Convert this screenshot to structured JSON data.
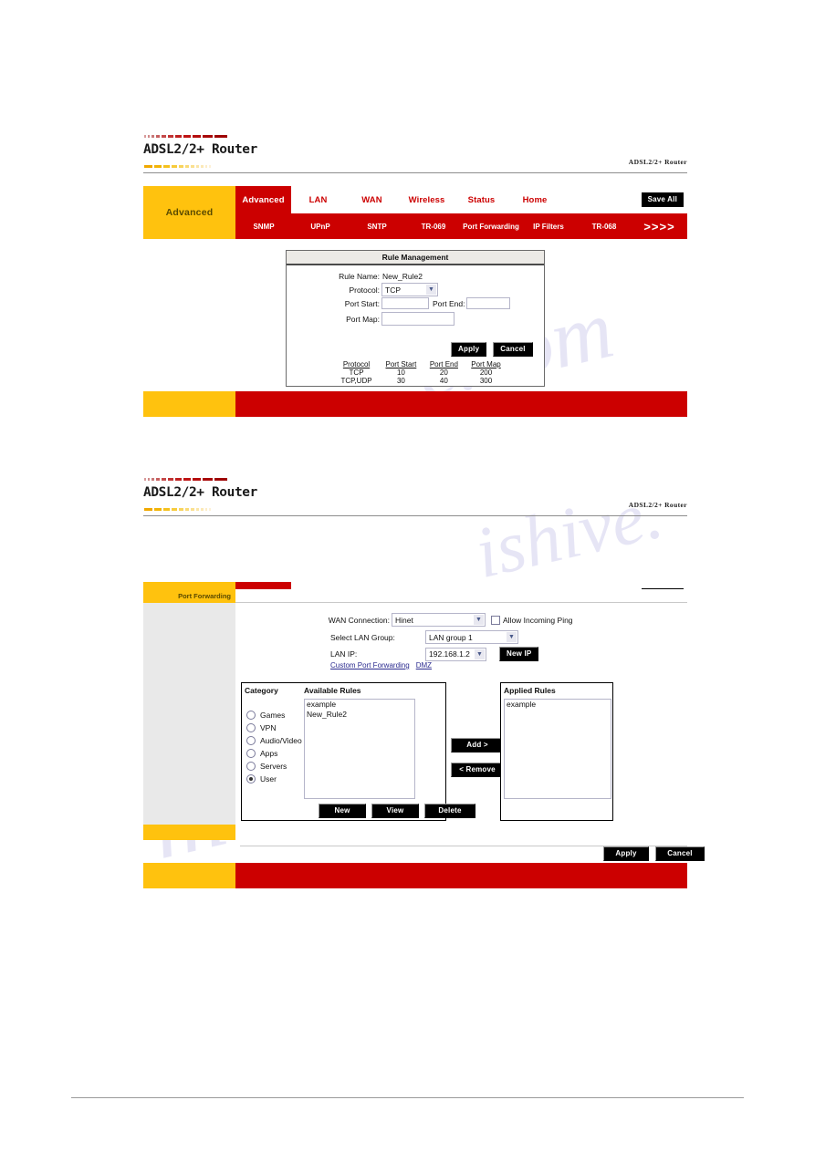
{
  "brand": {
    "logo_text": "ADSL2/2+ Router",
    "corner_text": "ADSL2/2+ Router"
  },
  "nav": {
    "left_label": "Advanced",
    "save_all_label": "Save All",
    "top_tabs": [
      {
        "label": "Advanced",
        "active": true
      },
      {
        "label": "LAN",
        "active": false
      },
      {
        "label": "WAN",
        "active": false
      },
      {
        "label": "Wireless",
        "active": false
      },
      {
        "label": "Status",
        "active": false
      },
      {
        "label": "Home",
        "active": false
      }
    ],
    "sub_tabs": [
      {
        "label": "SNMP"
      },
      {
        "label": "UPnP"
      },
      {
        "label": "SNTP"
      },
      {
        "label": "TR-069"
      },
      {
        "label": "Port Forwarding"
      },
      {
        "label": "IP Filters"
      },
      {
        "label": "TR-068"
      },
      {
        "label": ">>>>"
      }
    ]
  },
  "rule_management": {
    "title": "Rule Management",
    "rule_name_label": "Rule Name:",
    "rule_name_value": "New_Rule2",
    "protocol_label": "Protocol:",
    "protocol_value": "TCP",
    "port_start_label": "Port Start:",
    "port_start_value": "",
    "port_end_label": "Port End:",
    "port_end_value": "",
    "port_map_label": "Port Map:",
    "port_map_value": "",
    "apply_label": "Apply",
    "cancel_label": "Cancel",
    "table": {
      "headers": [
        "Protocol",
        "Port Start",
        "Port End",
        "Port Map"
      ],
      "rows": [
        [
          "TCP",
          "10",
          "20",
          "200"
        ],
        [
          "TCP,UDP",
          "30",
          "40",
          "300"
        ]
      ]
    }
  },
  "port_forwarding": {
    "sidebar_label": "Port Forwarding",
    "wan_connection_label": "WAN Connection:",
    "wan_connection_value": "Hinet",
    "allow_ping_label": "Allow Incoming Ping",
    "allow_ping_checked": false,
    "select_lan_group_label": "Select LAN Group:",
    "select_lan_group_value": "LAN group 1",
    "lan_ip_label": "LAN IP:",
    "lan_ip_value": "192.168.1.2",
    "new_ip_label": "New IP",
    "link_custom_port_forwarding": "Custom Port Forwarding",
    "link_dmz": "DMZ",
    "category_label": "Category",
    "categories": [
      {
        "label": "Games",
        "selected": false
      },
      {
        "label": "VPN",
        "selected": false
      },
      {
        "label": "Audio/Video",
        "selected": false
      },
      {
        "label": "Apps",
        "selected": false
      },
      {
        "label": "Servers",
        "selected": false
      },
      {
        "label": "User",
        "selected": true
      }
    ],
    "available_rules_label": "Available Rules",
    "available_rules": [
      "example",
      "New_Rule2"
    ],
    "new_label": "New",
    "view_label": "View",
    "delete_label": "Delete",
    "add_label": "Add >",
    "remove_label": "< Remove",
    "applied_rules_label": "Applied Rules",
    "applied_rules": [
      "example"
    ],
    "apply_label": "Apply",
    "cancel_label": "Cancel"
  },
  "watermark": {
    "t1": "e.com",
    "t2": "manualshive",
    "t3": "ishive."
  },
  "colors": {
    "red": "#CC0000",
    "yellow": "#FFC20E",
    "black": "#000000"
  }
}
